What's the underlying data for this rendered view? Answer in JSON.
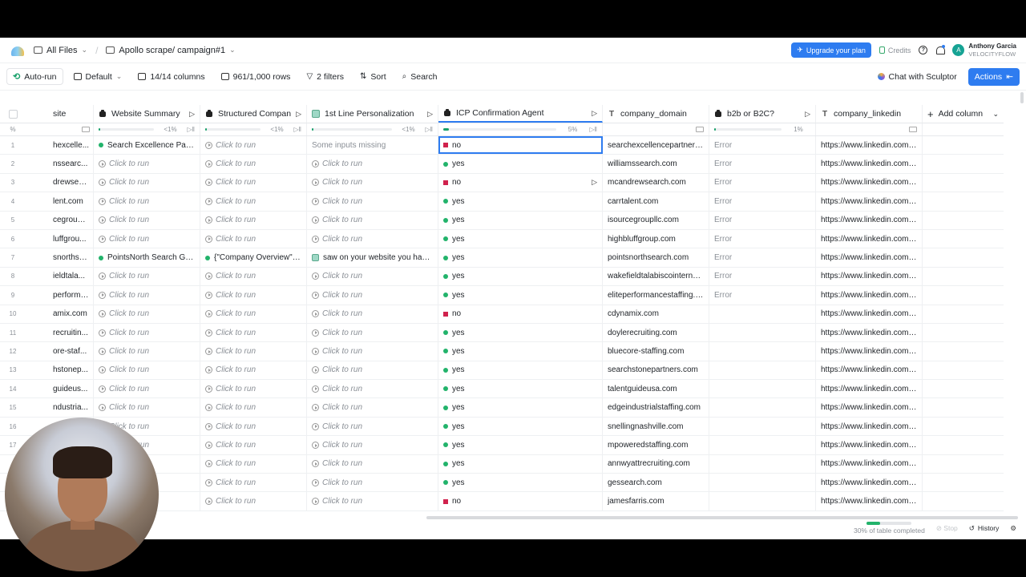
{
  "topbar": {
    "all_files": "All Files",
    "campaign": "Apollo scrape/ campaign#1",
    "upgrade": "Upgrade your plan",
    "credits": "Credits",
    "user_name": "Anthony Garcia",
    "user_org": "VELOCITYFLOW",
    "avatar_letter": "A"
  },
  "toolbar": {
    "auto_run": "Auto-run",
    "view": "Default",
    "columns": "14/14 columns",
    "rows": "961/1,000 rows",
    "filters": "2 filters",
    "sort": "Sort",
    "search": "Search",
    "chat": "Chat with Sculptor",
    "actions": "Actions"
  },
  "grid": {
    "progress_label": "%",
    "headers": {
      "site": "site",
      "website_summary": "Website Summary",
      "structured_company": "Structured Company",
      "first_line": "1st Line Personalization",
      "icp_agent": "ICP Confirmation Agent",
      "company_domain": "company_domain",
      "b2b": "b2b or B2C?",
      "company_linkedin": "company_linkedin",
      "add_column": "Add column"
    },
    "progress": {
      "website_summary": "<1%",
      "structured_company": "<1%",
      "first_line": "<1%",
      "icp_agent": "5%",
      "b2b": "1%"
    },
    "click_to_run": "Click to run",
    "rows": [
      {
        "n": "1",
        "site": "hexcelle...",
        "summary": "Search Excellence Part...",
        "summary_dot": true,
        "structured": "",
        "first": "Some inputs missing",
        "icp": "no",
        "domain": "searchexcellencepartners....",
        "b2b": "Error",
        "linkedin": "https://www.linkedin.com/..."
      },
      {
        "n": "2",
        "site": "nssearc...",
        "summary": "",
        "structured": "",
        "first": "",
        "icp": "yes",
        "domain": "williamssearch.com",
        "b2b": "Error",
        "linkedin": "https://www.linkedin.com/..."
      },
      {
        "n": "3",
        "site": "drewsea...",
        "summary": "",
        "structured": "",
        "first": "",
        "icp": "no",
        "domain": "mcandrewsearch.com",
        "b2b": "Error",
        "linkedin": "https://www.linkedin.com/..."
      },
      {
        "n": "4",
        "site": "lent.com",
        "summary": "",
        "structured": "",
        "first": "",
        "icp": "yes",
        "domain": "carrtalent.com",
        "b2b": "Error",
        "linkedin": "https://www.linkedin.com/..."
      },
      {
        "n": "5",
        "site": "cegroupl...",
        "summary": "",
        "structured": "",
        "first": "",
        "icp": "yes",
        "domain": "isourcegroupllc.com",
        "b2b": "Error",
        "linkedin": "https://www.linkedin.com/..."
      },
      {
        "n": "6",
        "site": "luffgrou...",
        "summary": "",
        "structured": "",
        "first": "",
        "icp": "yes",
        "domain": "highbluffgroup.com",
        "b2b": "Error",
        "linkedin": "https://www.linkedin.com/..."
      },
      {
        "n": "7",
        "site": "snorthse...",
        "summary": "PointsNorth Search Gro...",
        "summary_dot": true,
        "structured": "{\"Company Overview\":\"...",
        "structured_dot": true,
        "first": "saw on your website you have ...",
        "first_box": true,
        "icp": "yes",
        "domain": "pointsnorthsearch.com",
        "b2b": "Error",
        "linkedin": "https://www.linkedin.com/..."
      },
      {
        "n": "8",
        "site": "ieldtala...",
        "summary": "",
        "structured": "",
        "first": "",
        "icp": "yes",
        "domain": "wakefieldtalabiscointernat...",
        "b2b": "Error",
        "linkedin": "https://www.linkedin.com/..."
      },
      {
        "n": "9",
        "site": "performa...",
        "summary": "",
        "structured": "",
        "first": "",
        "icp": "yes",
        "domain": "eliteperformancestaffing.c...",
        "b2b": "Error",
        "linkedin": "https://www.linkedin.com/..."
      },
      {
        "n": "10",
        "site": "amix.com",
        "summary": "",
        "structured": "",
        "first": "",
        "icp": "no",
        "domain": "cdynamix.com",
        "b2b": "",
        "linkedin": "https://www.linkedin.com/..."
      },
      {
        "n": "11",
        "site": "recruitin...",
        "summary": "",
        "structured": "",
        "first": "",
        "icp": "yes",
        "domain": "doylerecruiting.com",
        "b2b": "",
        "linkedin": "https://www.linkedin.com/..."
      },
      {
        "n": "12",
        "site": "ore-staf...",
        "summary": "",
        "structured": "",
        "first": "",
        "icp": "yes",
        "domain": "bluecore-staffing.com",
        "b2b": "",
        "linkedin": "https://www.linkedin.com/..."
      },
      {
        "n": "13",
        "site": "hstonep...",
        "summary": "",
        "structured": "",
        "first": "",
        "icp": "yes",
        "domain": "searchstonepartners.com",
        "b2b": "",
        "linkedin": "https://www.linkedin.com/..."
      },
      {
        "n": "14",
        "site": "guideus...",
        "summary": "",
        "structured": "",
        "first": "",
        "icp": "yes",
        "domain": "talentguideusa.com",
        "b2b": "",
        "linkedin": "https://www.linkedin.com/..."
      },
      {
        "n": "15",
        "site": "ndustria...",
        "summary": "",
        "structured": "",
        "first": "",
        "icp": "yes",
        "domain": "edgeindustrialstaffing.com",
        "b2b": "",
        "linkedin": "https://www.linkedin.com/..."
      },
      {
        "n": "16",
        "site": "",
        "summary": "",
        "structured": "",
        "first": "",
        "icp": "yes",
        "domain": "snellingnashville.com",
        "b2b": "",
        "linkedin": "https://www.linkedin.com/..."
      },
      {
        "n": "17",
        "site": "",
        "summary": "",
        "structured": "",
        "first": "",
        "icp": "yes",
        "domain": "mpoweredstaffing.com",
        "b2b": "",
        "linkedin": "https://www.linkedin.com/..."
      },
      {
        "n": "",
        "site": "",
        "summary": "",
        "structured": "",
        "first": "",
        "icp": "yes",
        "domain": "annwyattrecruiting.com",
        "b2b": "",
        "linkedin": "https://www.linkedin.com/..."
      },
      {
        "n": "",
        "site": "",
        "summary": "",
        "structured": "",
        "first": "",
        "icp": "yes",
        "domain": "gessearch.com",
        "b2b": "",
        "linkedin": "https://www.linkedin.com/..."
      },
      {
        "n": "",
        "site": "",
        "summary": "",
        "structured": "",
        "first": "",
        "icp": "no",
        "domain": "jamesfarris.com",
        "b2b": "",
        "linkedin": "https://www.linkedin.com/..."
      }
    ]
  },
  "footer": {
    "completed": "30% of table completed",
    "completed_fraction": 0.3,
    "stop": "Stop",
    "history": "History"
  },
  "colors": {
    "accent": "#2e7cf0",
    "yes_dot": "#22b36b",
    "no_square": "#d0224d"
  }
}
